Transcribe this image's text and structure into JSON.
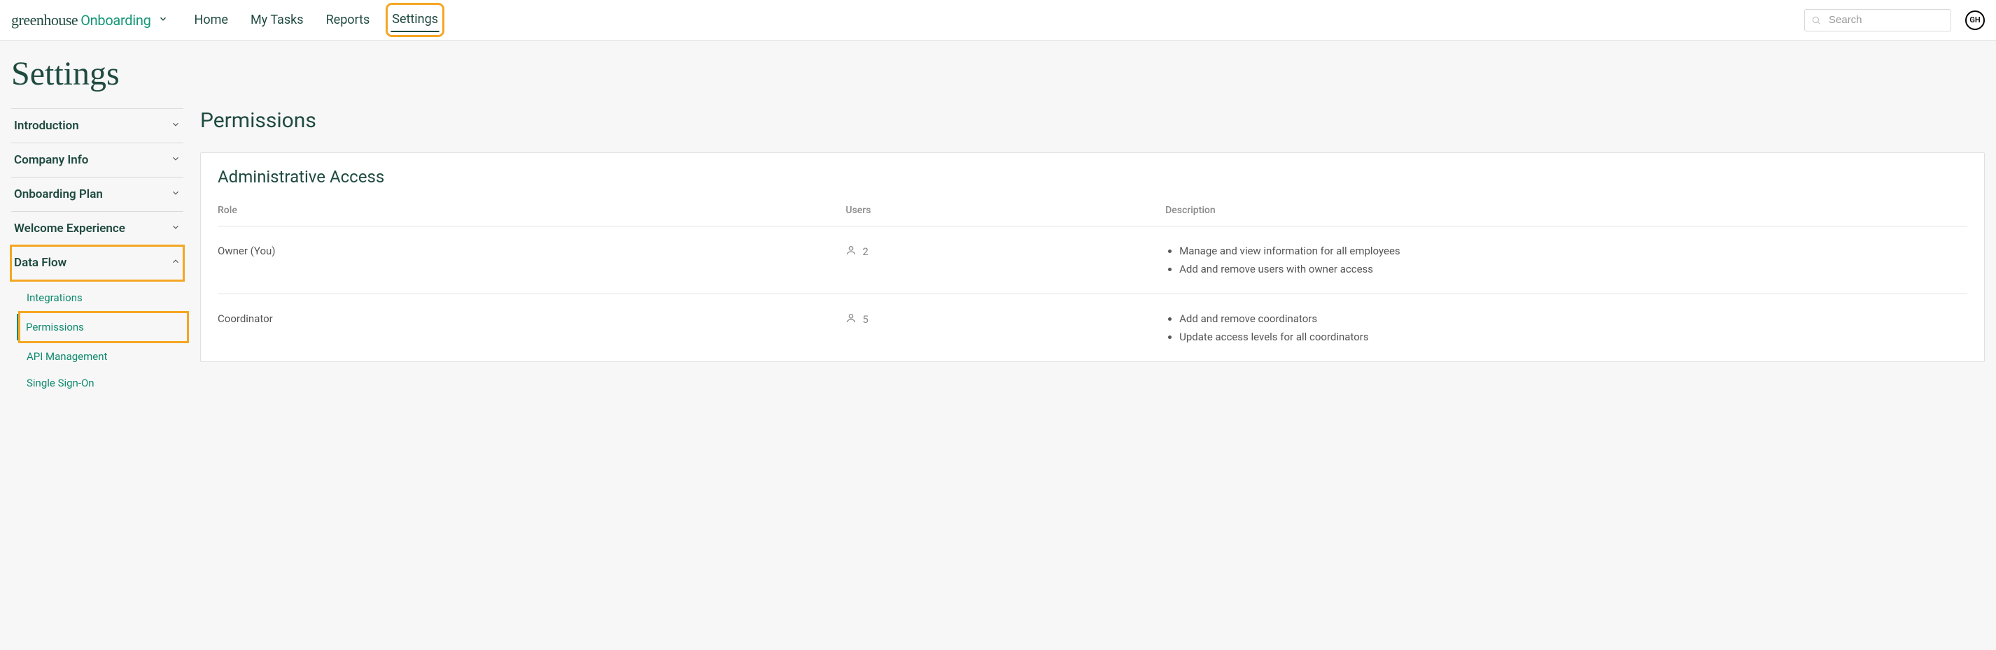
{
  "logo": {
    "brand": "greenhouse",
    "product": "Onboarding"
  },
  "nav": {
    "items": [
      "Home",
      "My Tasks",
      "Reports",
      "Settings"
    ],
    "active": "Settings"
  },
  "search": {
    "placeholder": "Search"
  },
  "avatar": {
    "initials": "GH"
  },
  "page_title": "Settings",
  "sidebar": {
    "sections": [
      {
        "label": "Introduction",
        "expanded": false
      },
      {
        "label": "Company Info",
        "expanded": false
      },
      {
        "label": "Onboarding Plan",
        "expanded": false
      },
      {
        "label": "Welcome Experience",
        "expanded": false
      },
      {
        "label": "Data Flow",
        "expanded": true,
        "children": [
          "Integrations",
          "Permissions",
          "API Management",
          "Single Sign-On"
        ],
        "active_child": "Permissions"
      }
    ]
  },
  "main": {
    "title": "Permissions",
    "panel_title": "Administrative Access",
    "columns": {
      "role": "Role",
      "users": "Users",
      "description": "Description"
    },
    "rows": [
      {
        "role": "Owner (You)",
        "users": "2",
        "description": [
          "Manage and view information for all employees",
          "Add and remove users with owner access"
        ]
      },
      {
        "role": "Coordinator",
        "users": "5",
        "description": [
          "Add and remove coordinators",
          "Update access levels for all coordinators"
        ]
      }
    ]
  }
}
